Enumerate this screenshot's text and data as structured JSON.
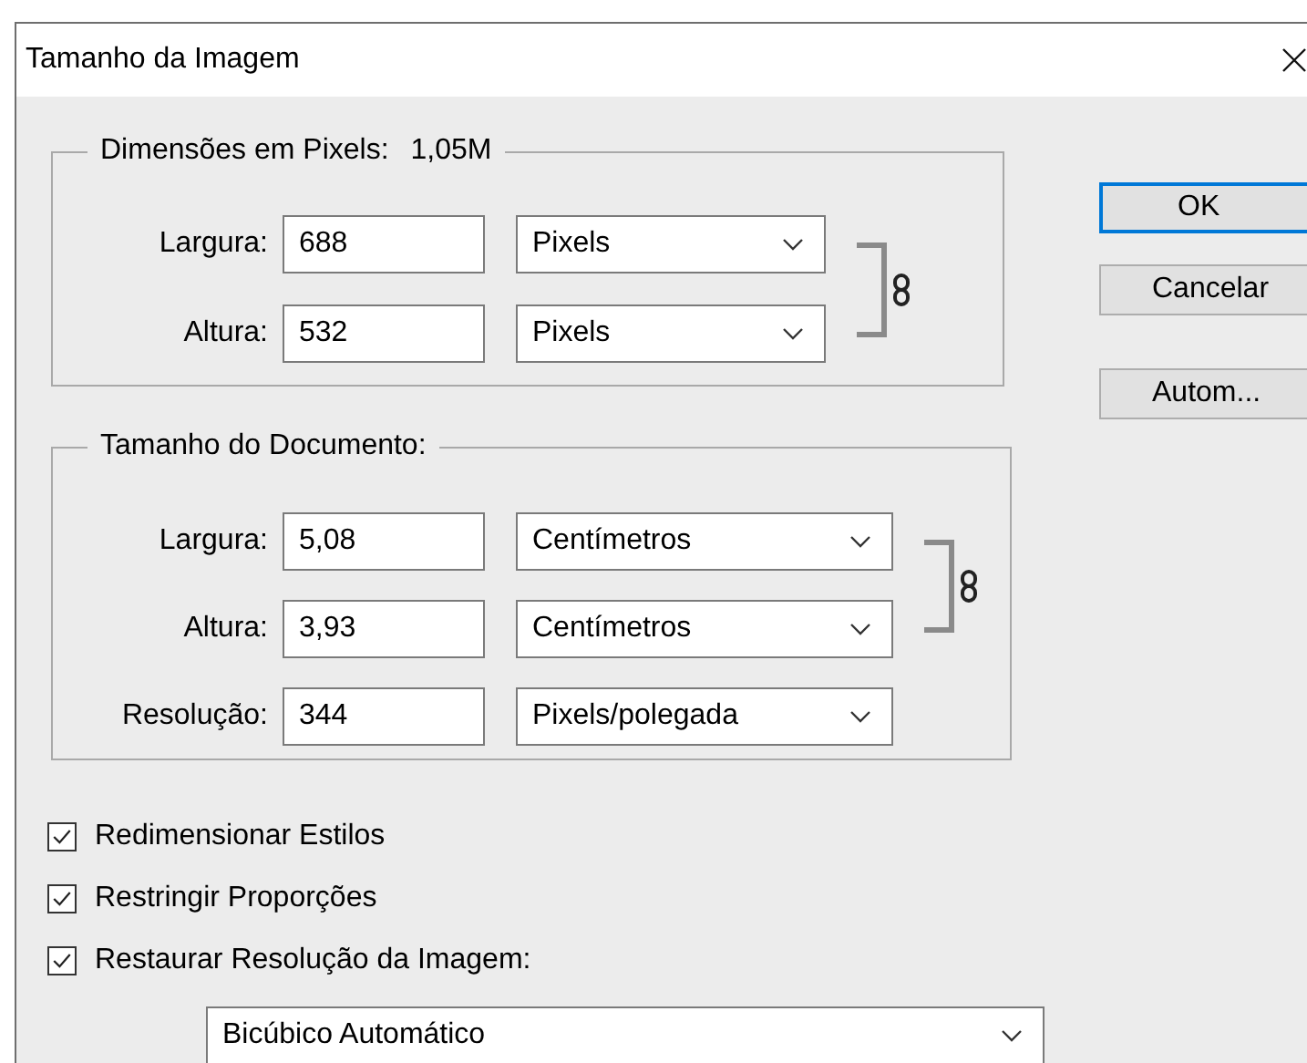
{
  "window": {
    "title": "Tamanho da Imagem"
  },
  "groups": [
    {
      "legend": "Dimensões em Pixels:",
      "value": "1,05M",
      "rows": [
        {
          "label": "Largura:",
          "value": "688",
          "unit": "Pixels",
          "chained": true
        },
        {
          "label": "Altura:",
          "value": "532",
          "unit": "Pixels",
          "chained": true
        }
      ]
    },
    {
      "legend": "Tamanho do Documento:",
      "rows": [
        {
          "label": "Largura:",
          "value": "5,08",
          "unit": "Centímetros",
          "chained": true
        },
        {
          "label": "Altura:",
          "value": "3,93",
          "unit": "Centímetros",
          "chained": true
        },
        {
          "label": "Resolução:",
          "value": "344",
          "unit": "Pixels/polegada",
          "chained": false
        }
      ]
    }
  ],
  "checkboxes": [
    {
      "label": "Redimensionar Estilos",
      "checked": true
    },
    {
      "label": "Restringir Proporções",
      "checked": true
    },
    {
      "label": "Restaurar Resolução da Imagem:",
      "checked": true
    }
  ],
  "resample": {
    "value": "Bicúbico Automático"
  },
  "buttons": [
    {
      "label": "OK",
      "default": true
    },
    {
      "label": "Cancelar",
      "default": false
    },
    {
      "label": "Autom...",
      "default": false
    }
  ]
}
